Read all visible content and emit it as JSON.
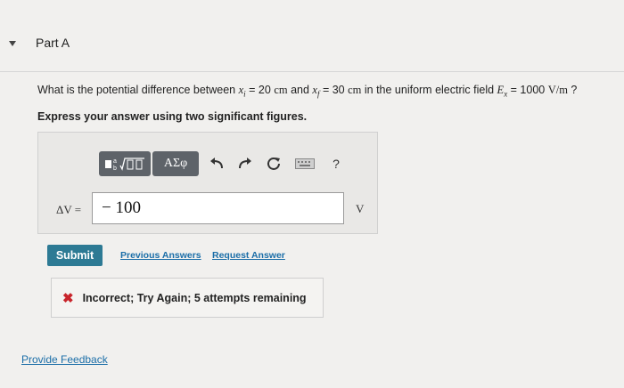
{
  "part": {
    "title": "Part A"
  },
  "question": {
    "prefix": "What is the potential difference between ",
    "x_i_var": "x",
    "x_i_sub": "i",
    "x_i_eq": " = 20 ",
    "x_i_unit": "cm",
    "and_text": " and ",
    "x_f_var": "x",
    "x_f_sub": "f",
    "x_f_eq": " = 30 ",
    "x_f_unit": "cm",
    "mid": " in the uniform electric field ",
    "field_var": "E",
    "field_sub": "x",
    "field_eq": " = 1000 ",
    "field_unit": "V/m",
    "suffix": " ?"
  },
  "instruction": "Express your answer using two significant figures.",
  "toolbar": {
    "templates_icon": "templates-icon",
    "greek_label": "ΑΣφ",
    "undo_icon": "undo-icon",
    "redo_icon": "redo-icon",
    "reset_icon": "reset-icon",
    "keyboard_icon": "keyboard-icon",
    "help_label": "?"
  },
  "answer": {
    "label": "ΔV =",
    "value": "− 100",
    "unit": "V"
  },
  "actions": {
    "submit_label": "Submit",
    "previous_answers_label": "Previous Answers",
    "request_answer_label": "Request Answer"
  },
  "feedback": {
    "icon": "x-icon",
    "message": "Incorrect; Try Again; 5 attempts remaining",
    "color": "#c8242b"
  },
  "footer": {
    "provide_feedback_label": "Provide Feedback"
  },
  "colors": {
    "submit": "#2d7a94",
    "link": "#1b6ea8",
    "toolbar_button": "#5e6369"
  }
}
